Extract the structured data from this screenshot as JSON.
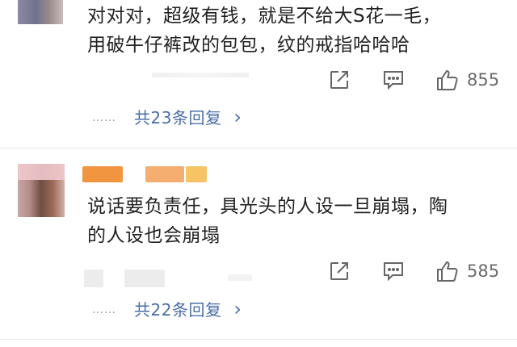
{
  "comments": [
    {
      "text_line1": "对对对，超级有钱，就是不给大S花一毛，",
      "text_line2": "用破牛仔裤改的包包，纹的戒指哈哈哈",
      "like_count": "855",
      "replies": {
        "dots": "……",
        "label": "共23条回复",
        "chevron": "›"
      },
      "icons": [
        "share-icon",
        "comment-icon",
        "like-icon"
      ]
    },
    {
      "text_line1": "说话要负责任，具光头的人设一旦崩塌，陶",
      "text_line2": "的人设也会崩塌",
      "like_count": "585",
      "replies": {
        "dots": "……",
        "label": "共22条回复",
        "chevron": "›"
      },
      "icons": [
        "share-icon",
        "comment-icon",
        "like-icon"
      ]
    }
  ],
  "colors": {
    "text": "#222222",
    "reply_link": "#4a6ea8",
    "icon": "#666666",
    "username_orange": "#f08a2c",
    "username_yellow": "#f5b94a"
  }
}
